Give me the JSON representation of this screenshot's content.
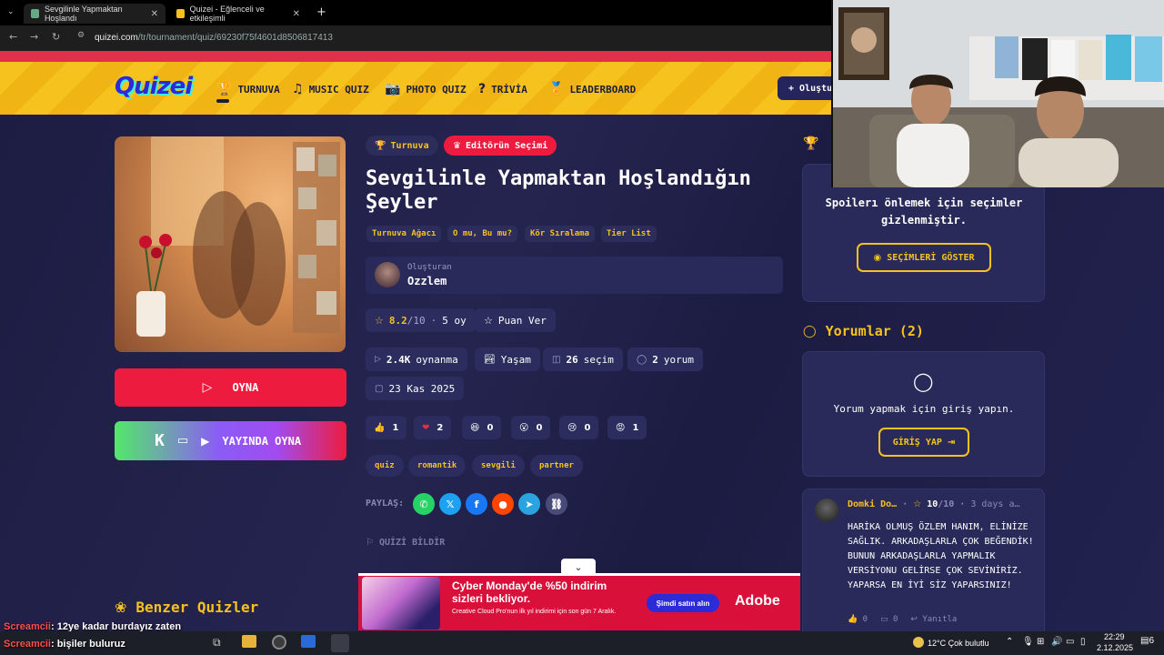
{
  "browser": {
    "tabs": [
      {
        "title": "Sevgilinle Yapmaktan Hoşlandı"
      },
      {
        "title": "Quizei - Eğlenceli ve etkileşimli"
      }
    ],
    "url_domain": "quizei.com",
    "url_path": "/tr/tournament/quiz/69230f75f4601d8506817413"
  },
  "site": {
    "logo": "Quizei",
    "nav": [
      "TURNUVA",
      "MUSIC QUIZ",
      "PHOTO QUIZ",
      "TRİVİA",
      "LEADERBOARD"
    ],
    "create_label": "+ Oluştu"
  },
  "quiz": {
    "badges": {
      "type": "Turnuva",
      "editor": "Editörün Seçimi"
    },
    "title": "Sevgilinle Yapmaktan Hoşlandığın Şeyler",
    "modes": [
      "Turnuva Ağacı",
      "O mu, Bu mu?",
      "Kör Sıralama",
      "Tier List"
    ],
    "creator_label": "Oluşturan",
    "creator_name": "Ozzlem",
    "rating": "8.2",
    "rating_max": "/10",
    "votes": "5 oy",
    "rate_label": "Puan Ver",
    "plays": "2.4K",
    "plays_label": "oynanma",
    "category": "Yaşam",
    "choices": "26",
    "choices_label": "seçim",
    "comments": "2",
    "comments_label": "yorum",
    "date": "23 Kas 2025",
    "reactions": [
      {
        "icon": "thumbs-up-icon",
        "glyph": "👍",
        "count": "1"
      },
      {
        "icon": "heart-icon",
        "glyph": "❤",
        "count": "2"
      },
      {
        "icon": "laugh-icon",
        "glyph": "😆",
        "count": "0"
      },
      {
        "icon": "wow-icon",
        "glyph": "😮",
        "count": "0"
      },
      {
        "icon": "sad-icon",
        "glyph": "😢",
        "count": "0"
      },
      {
        "icon": "angry-icon",
        "glyph": "😡",
        "count": "1"
      }
    ],
    "tags": [
      "quiz",
      "romantik",
      "sevgili",
      "partner"
    ],
    "share_label": "PAYLAŞ:",
    "report_label": "QUİZİ BİLDİR",
    "play_label": "OYNA",
    "live_label": "YAYINDA OYNA",
    "similar_label": "Benzer Quizler"
  },
  "sidebar": {
    "spoiler_text": "Spoilerı önlemek için seçimler gizlenmiştir.",
    "show_choices": "SEÇİMLERİ GÖSTER",
    "comments_header": "Yorumlar (2)",
    "login_prompt": "Yorum yapmak için giriş yapın.",
    "login_button": "GİRİŞ YAP",
    "comment": {
      "author": "Domki Do…",
      "rating": "10",
      "rating_max": "/10",
      "time": "3 days a…",
      "text": "HARİKA OLMUŞ ÖZLEM HANIM, ELİNİZE SAĞLIK. ARKADAŞLARLA ÇOK BEĞENDİK! BUNUN ARKADAŞLARLA YAPMALIK VERSİYONU GELİRSE ÇOK SEVİNİRİZ. YAPARSA EN İYİ SİZ YAPARSINIZ!",
      "likes": "0",
      "replies": "0",
      "reply_label": "Yanıtla"
    }
  },
  "ad": {
    "headline": "Cyber Monday'de %50 indirim sizleri bekliyor.",
    "sub": "Creative Cloud Pro'nun ilk yıl indirimi için son gün 7 Aralık.",
    "cta": "Şimdi satın alın",
    "brand": "Adobe"
  },
  "chat": [
    {
      "user": "Screamcii",
      "msg": ": 12ye kadar burdayız zaten"
    },
    {
      "user": "Screamcii",
      "msg": ": bişiler buluruz"
    }
  ],
  "taskbar": {
    "weather": "12°C  Çok bulutlu",
    "time": "22:29",
    "date": "2.12.2025",
    "notif": "6"
  },
  "colors": {
    "accent": "#f6c21d",
    "primary_red": "#ed1c3f",
    "bg": "#1f1f45"
  }
}
